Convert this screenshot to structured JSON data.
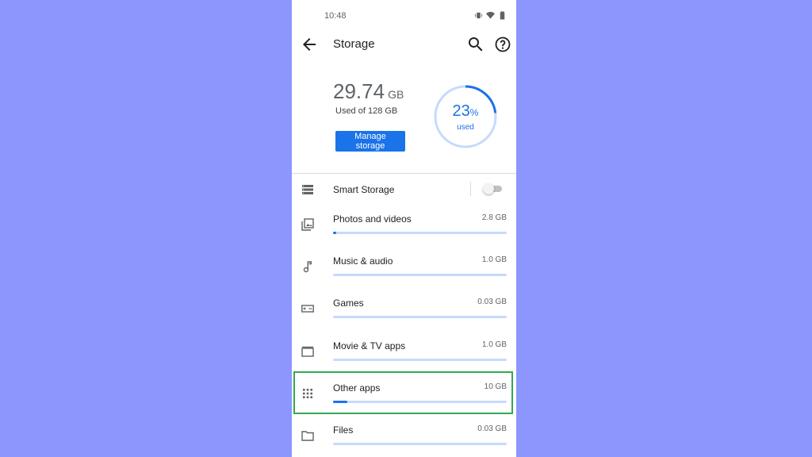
{
  "status_bar": {
    "time": "10:48"
  },
  "app_bar": {
    "title": "Storage"
  },
  "summary": {
    "used_value": "29.74",
    "used_unit": "GB",
    "used_of": "Used of 128 GB",
    "manage_button": "Manage storage",
    "percent": "23",
    "percent_sign": "%",
    "percent_label": "used",
    "percent_fraction": 0.23
  },
  "smart_storage": {
    "label": "Smart Storage",
    "enabled": false
  },
  "categories": [
    {
      "label": "Photos and videos",
      "size": "2.8 GB",
      "fill": 0.02,
      "icon": "photo-library-icon"
    },
    {
      "label": "Music & audio",
      "size": "1.0 GB",
      "fill": 0.0,
      "icon": "music-note-icon"
    },
    {
      "label": "Games",
      "size": "0.03 GB",
      "fill": 0.0,
      "icon": "gamepad-icon"
    },
    {
      "label": "Movie & TV apps",
      "size": "1.0 GB",
      "fill": 0.0,
      "icon": "movie-icon"
    },
    {
      "label": "Other apps",
      "size": "10 GB",
      "fill": 0.08,
      "icon": "apps-grid-icon"
    },
    {
      "label": "Files",
      "size": "0.03 GB",
      "fill": 0.0,
      "icon": "folder-icon"
    }
  ],
  "colors": {
    "accent": "#1a73e8",
    "highlight": "#34a853",
    "background": "#8c96fd"
  }
}
